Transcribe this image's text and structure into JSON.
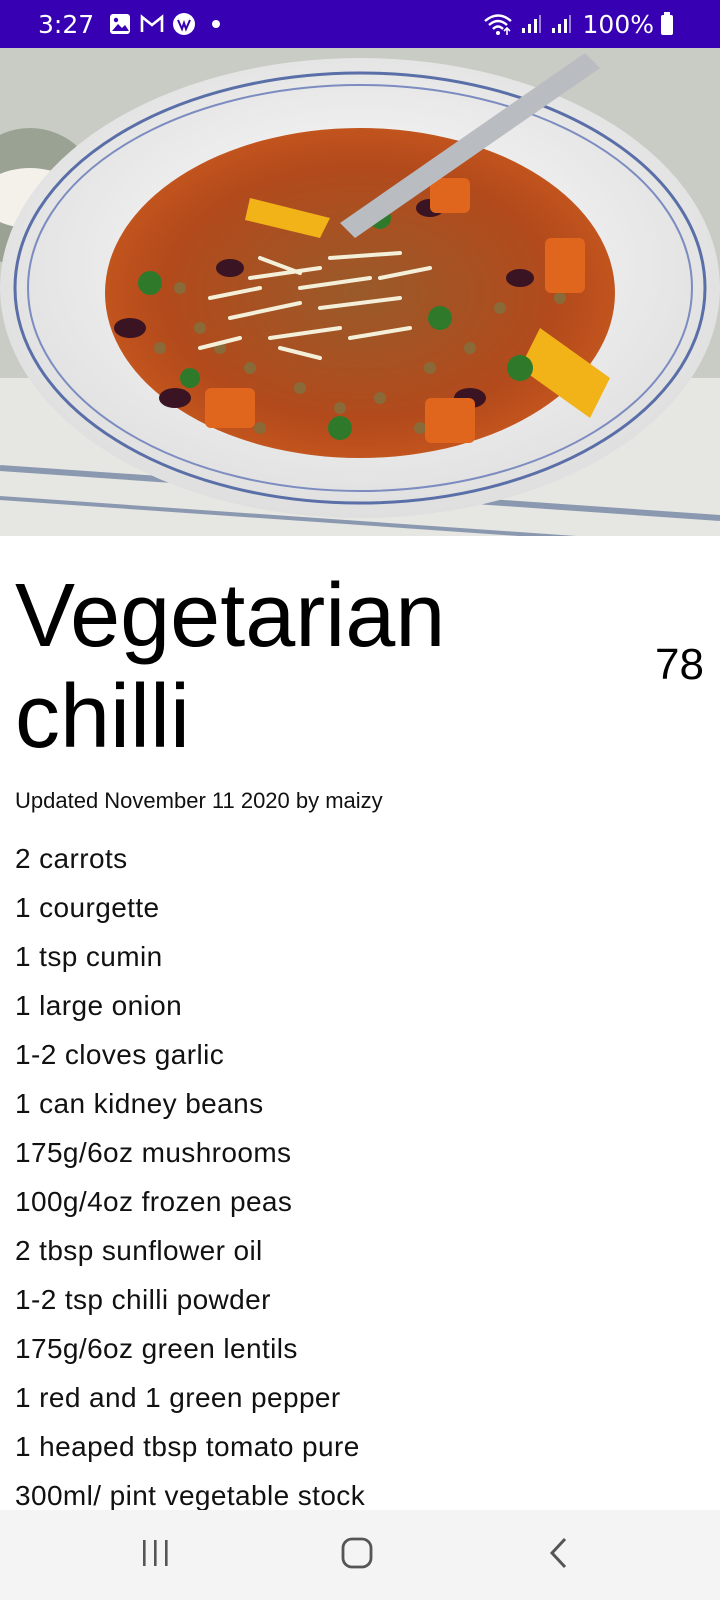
{
  "status_bar": {
    "time": "3:27",
    "battery": "100%",
    "left_icons": [
      "image-icon",
      "gmail-icon",
      "app-icon",
      "dot-icon"
    ],
    "right_icons": [
      "wifi-icon",
      "signal-icon",
      "signal-icon",
      "battery-icon"
    ]
  },
  "recipe": {
    "title": "Vegetarian chilli",
    "rating": "78",
    "updated": "Updated November 11 2020 by maizy",
    "ingredients": [
      "2 carrots",
      "1 courgette",
      "1 tsp cumin",
      "1 large onion",
      "1-2 cloves garlic",
      "1 can kidney beans",
      "175g/6oz mushrooms",
      "100g/4oz frozen peas",
      "2 tbsp sunflower oil",
      "1-2 tsp chilli powder",
      "175g/6oz green lentils",
      "1 red and 1 green pepper",
      "1 heaped tbsp tomato pure",
      "300ml/ pint vegetable stock"
    ]
  },
  "nav_bar": {
    "icons": [
      "recent-apps-icon",
      "home-icon",
      "back-icon"
    ]
  },
  "colors": {
    "status_bar": "#3700b3",
    "nav_bar": "#f4f4f4",
    "background": "#ffffff"
  }
}
